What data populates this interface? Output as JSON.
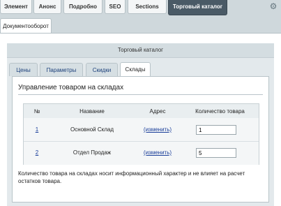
{
  "top_tabs": [
    {
      "label": "Элемент"
    },
    {
      "label": "Анонс"
    },
    {
      "label": "Подробно"
    },
    {
      "label": "SEO"
    },
    {
      "label": "Sections"
    },
    {
      "label": "Торговый каталог"
    }
  ],
  "second_tab": {
    "label": "Документооборот"
  },
  "panel": {
    "title": "Торговый каталог",
    "sub_tabs": [
      {
        "label": "Цены"
      },
      {
        "label": "Параметры"
      },
      {
        "label": "Скидки"
      },
      {
        "label": "Склады"
      }
    ],
    "section_title": "Управление товаром на складах",
    "table": {
      "headers": [
        "№",
        "Название",
        "Адрес",
        "Количество товара"
      ],
      "rows": [
        {
          "num": "1",
          "name": "Основной Склад",
          "address_link": "(изменить)",
          "quantity": "1"
        },
        {
          "num": "2",
          "name": "Отдел Продаж",
          "address_link": "(изменить)",
          "quantity": "5"
        }
      ]
    },
    "note": "Количество товара на складах носит информационный характер и не влияет на расчет остатков товара."
  },
  "icons": {
    "settings": "gear-icon"
  },
  "colors": {
    "active_tab": "#4a5a66",
    "link": "#1b3f9a"
  }
}
